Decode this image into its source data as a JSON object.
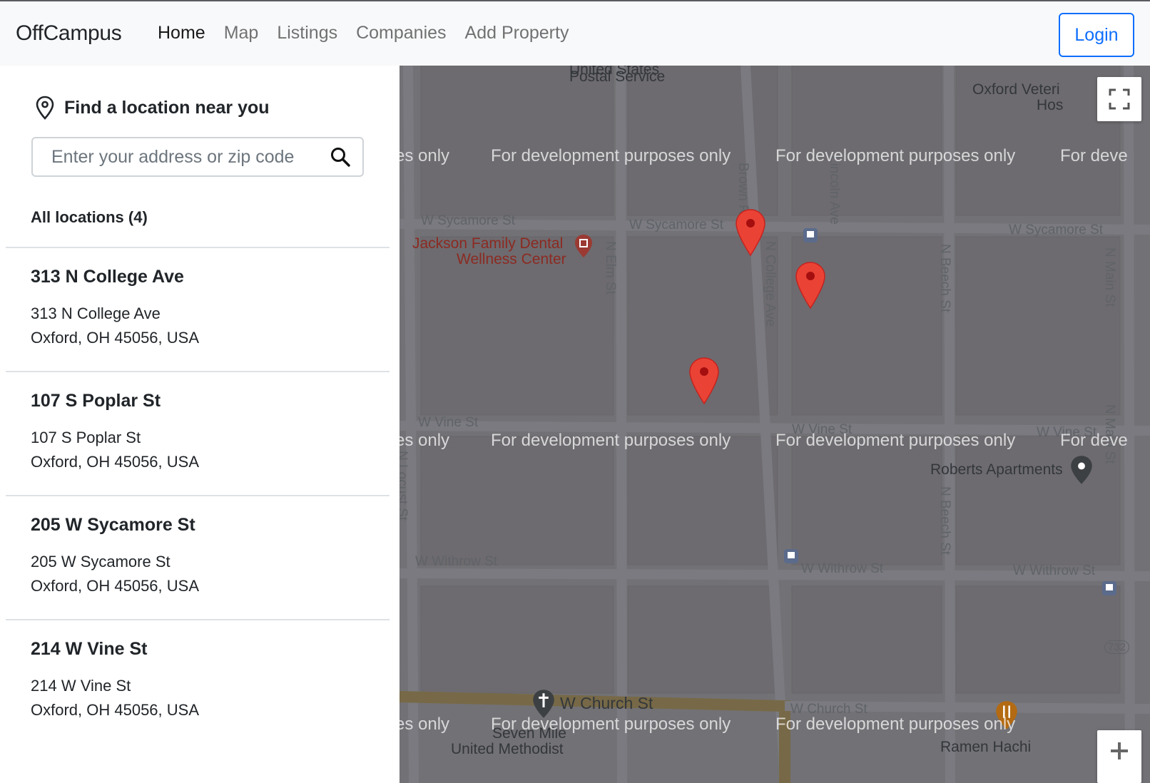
{
  "navbar": {
    "brand": "OffCampus",
    "links": [
      {
        "label": "Home",
        "active": true
      },
      {
        "label": "Map",
        "active": false
      },
      {
        "label": "Listings",
        "active": false
      },
      {
        "label": "Companies",
        "active": false
      },
      {
        "label": "Add Property",
        "active": false
      }
    ],
    "login_label": "Login"
  },
  "sidebar": {
    "title": "Find a location near you",
    "search_placeholder": "Enter your address or zip code",
    "all_locations_label": "All locations (4)",
    "locations": [
      {
        "name": "313 N College Ave",
        "line1": "313 N College Ave",
        "line2": "Oxford, OH 45056, USA"
      },
      {
        "name": "107 S Poplar St",
        "line1": "107 S Poplar St",
        "line2": "Oxford, OH 45056, USA"
      },
      {
        "name": "205 W Sycamore St",
        "line1": "205 W Sycamore St",
        "line2": "Oxford, OH 45056, USA"
      },
      {
        "name": "214 W Vine St",
        "line1": "214 W Vine St",
        "line2": "Oxford, OH 45056, USA"
      }
    ]
  },
  "map": {
    "watermark": "For development purposes only",
    "watermark_partial_left": "es only",
    "watermark_partial_right": "For deve",
    "streets": {
      "w_sycamore": "W Sycamore St",
      "w_vine": "W Vine St",
      "w_withrow": "W Withrow St",
      "w_church": "W Church St",
      "n_elm": "N Elm St",
      "n_college": "N College Ave",
      "n_beech": "N Beech St",
      "n_main": "N Main St",
      "brown_rd": "Brown Rd",
      "lincoln_ave": "Lincoln Ave",
      "n_locust": "N Locust St",
      "route_732": "732"
    },
    "pois": {
      "postal": "Postal Service",
      "postal_top": "United States",
      "jackson_line1": "Jackson Family Dental",
      "jackson_line2": "Wellness Center",
      "oxford_vet_line1": "Oxford Veteri",
      "oxford_vet_line2": "Hos",
      "roberts": "Roberts Apartments",
      "seven_mile_line1": "Seven Mile",
      "seven_mile_line2": "United Methodist",
      "ramen": "Ramen Hachi"
    },
    "colors": {
      "marker": "#ea4335",
      "marker_dot": "#a50e0e",
      "primary": "#0d6efd"
    }
  }
}
